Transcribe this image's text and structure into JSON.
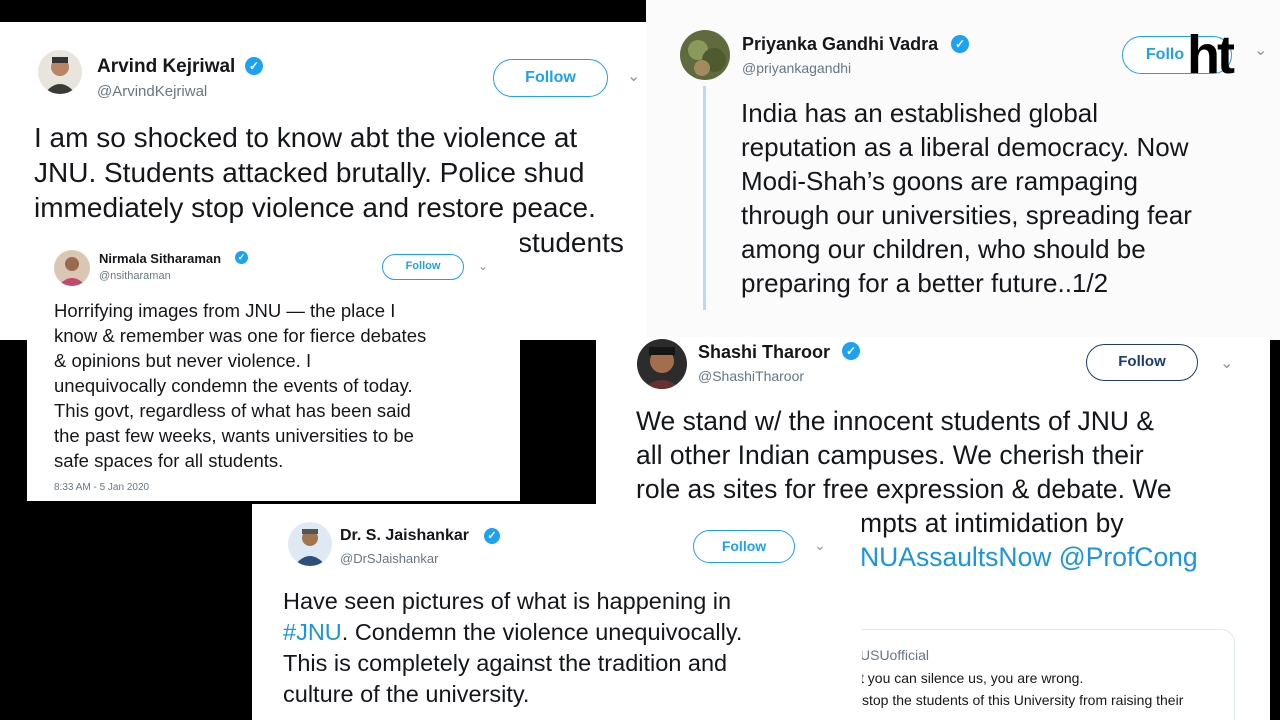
{
  "brand": {
    "logo_text": "ht",
    "color": "#1da1f2"
  },
  "tweets": {
    "kejriwal": {
      "name": "Arvind Kejriwal",
      "handle": "@ArvindKejriwal",
      "follow_label": "Follow",
      "lines": [
        "I am so shocked to know abt the violence at",
        "JNU. Students attacked brutally. Police shud",
        "immediately stop violence and restore peace.",
        "students"
      ]
    },
    "priyanka": {
      "name": "Priyanka Gandhi Vadra",
      "handle": "@priyankagandhi",
      "follow_label": "Follo",
      "text": "India has an established global\nreputation as a liberal democracy. Now\nModi-Shah’s goons are rampaging\nthrough our universities, spreading fear\namong our children, who should be\npreparing for a better future..1/2"
    },
    "nirmala": {
      "name": "Nirmala Sitharaman",
      "handle": "@nsitharaman",
      "follow_label": "Follow",
      "text": "Horrifying images from JNU — the place I\nknow & remember was one for fierce debates\n& opinions but never violence. I\nunequivocally condemn the events of today.\nThis govt, regardless of what has been said\nthe past few weeks, wants universities to be\nsafe spaces for all students.",
      "timestamp": "8:33 AM - 5 Jan 2020"
    },
    "tharoor": {
      "name": "Shashi Tharoor",
      "handle": "@ShashiTharoor",
      "follow_label": "Follow",
      "lines": [
        "We stand w/ the innocent students of JNU &",
        "all other Indian campuses. We cherish their",
        "role as sites for free expression & debate. We",
        "mpts at intimidation by"
      ],
      "link_line": "NUAssaultsNow @ProfCong",
      "quoted": {
        "handle_partial": "USUofficial",
        "line1": "t you can silence us, you are wrong.",
        "line2": "stop the students of this University from raising their"
      }
    },
    "jaishankar": {
      "name": "Dr. S. Jaishankar",
      "handle": "@DrSJaishankar",
      "follow_label": "Follow",
      "line1": "Have seen pictures of what is happening in",
      "hashtag": "#JNU",
      "line2_rest": ". Condemn the violence unequivocally.",
      "line3": "This is completely against the tradition and",
      "line4": "culture of the university."
    }
  }
}
